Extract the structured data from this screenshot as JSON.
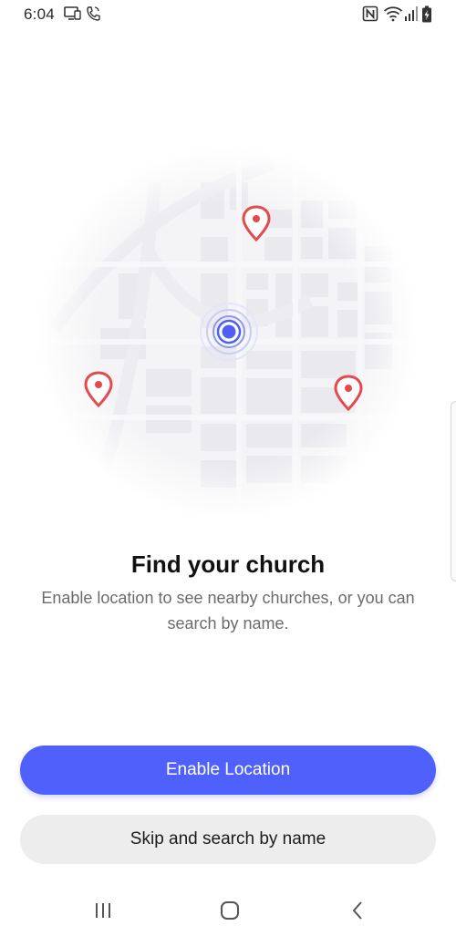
{
  "status_bar": {
    "time": "6:04",
    "icons": [
      "screen-mirror-icon",
      "phone-call-icon",
      "nfc-icon",
      "wifi-icon",
      "signal-icon",
      "battery-charging-icon"
    ]
  },
  "illustration": {
    "icons": [
      "map-icon",
      "map-pin-icon",
      "current-location-icon"
    ],
    "pin_color": "#e5484d",
    "location_color": "#4f5ff6"
  },
  "content": {
    "title": "Find your church",
    "subtitle": "Enable location to see nearby churches, or you can search by name."
  },
  "actions": {
    "enable_location_label": "Enable Location",
    "skip_label": "Skip and search by name",
    "accent_color": "#5061fb"
  },
  "nav_bar": {
    "icons": [
      "recent-apps-icon",
      "home-icon",
      "back-icon"
    ]
  }
}
